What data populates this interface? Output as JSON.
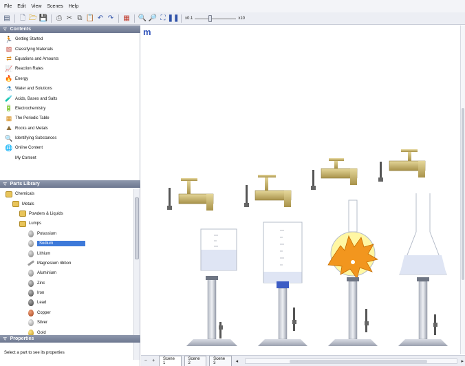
{
  "menu": [
    "File",
    "Edit",
    "View",
    "Scenes",
    "Help"
  ],
  "toolbar": {
    "zoom_min": "x0.1",
    "zoom_max": "x10",
    "zoom_level": 0.35
  },
  "contents": {
    "header": "Contents",
    "items": [
      {
        "label": "Getting Started",
        "icon": "running-person-icon"
      },
      {
        "label": "Classifying Materials",
        "icon": "materials-icon"
      },
      {
        "label": "Equations and Amounts",
        "icon": "equation-icon"
      },
      {
        "label": "Reaction Rates",
        "icon": "graph-icon"
      },
      {
        "label": "Energy",
        "icon": "flame-icon"
      },
      {
        "label": "Water and Solutions",
        "icon": "flask-icon"
      },
      {
        "label": "Acids, Bases and Salts",
        "icon": "bottle-icon"
      },
      {
        "label": "Electrochemistry",
        "icon": "battery-icon"
      },
      {
        "label": "The Periodic Table",
        "icon": "periodic-table-icon"
      },
      {
        "label": "Rocks and Metals",
        "icon": "rocks-icon"
      },
      {
        "label": "Identifying Substances",
        "icon": "magnifier-icon"
      },
      {
        "label": "Online Content",
        "icon": "globe-icon"
      },
      {
        "label": "My Content",
        "icon": ""
      }
    ]
  },
  "parts_library": {
    "header": "Parts Library",
    "tree": [
      {
        "label": "Chemicals",
        "level": 0,
        "icon": "chemicals-icon",
        "selected": false
      },
      {
        "label": "Metals",
        "level": 1,
        "icon": "metals-icon",
        "selected": false
      },
      {
        "label": "Powders & Liquids",
        "level": 2,
        "icon": "folder-icon",
        "selected": false
      },
      {
        "label": "Lumps",
        "level": 2,
        "icon": "folder-open-icon",
        "selected": false
      },
      {
        "label": "Potassium",
        "level": 3,
        "icon": "lump-icon",
        "selected": false
      },
      {
        "label": "Sodium",
        "level": 3,
        "icon": "lump-icon",
        "selected": true
      },
      {
        "label": "Lithium",
        "level": 3,
        "icon": "lump-icon",
        "selected": false
      },
      {
        "label": "Magnesium ribbon",
        "level": 3,
        "icon": "ribbon-icon",
        "selected": false
      },
      {
        "label": "Aluminium",
        "level": 3,
        "icon": "lump-icon",
        "selected": false
      },
      {
        "label": "Zinc",
        "level": 3,
        "icon": "lump-icon",
        "selected": false
      },
      {
        "label": "Iron",
        "level": 3,
        "icon": "lump-icon",
        "selected": false
      },
      {
        "label": "Lead",
        "level": 3,
        "icon": "lump-icon",
        "selected": false
      },
      {
        "label": "Copper",
        "level": 3,
        "icon": "lump-icon",
        "selected": false
      },
      {
        "label": "Silver",
        "level": 3,
        "icon": "lump-icon",
        "selected": false
      },
      {
        "label": "Gold",
        "level": 3,
        "icon": "lump-icon",
        "selected": false
      }
    ]
  },
  "properties": {
    "header": "Properties",
    "status": "Select a part to see its properties"
  },
  "canvas": {
    "mark": "m"
  },
  "scenes": {
    "add_label": "+",
    "remove_label": "−",
    "tabs": [
      "Scene 1",
      "Scene 2",
      "Scene 3"
    ],
    "active": 0
  },
  "colors": {
    "panel_header": "#7a849c",
    "selection": "#3d79d9",
    "tap": "#c2ae63",
    "liquid": "#dfe5f4",
    "flame_orange": "#f2961e",
    "flame_yellow": "#ffe300"
  }
}
